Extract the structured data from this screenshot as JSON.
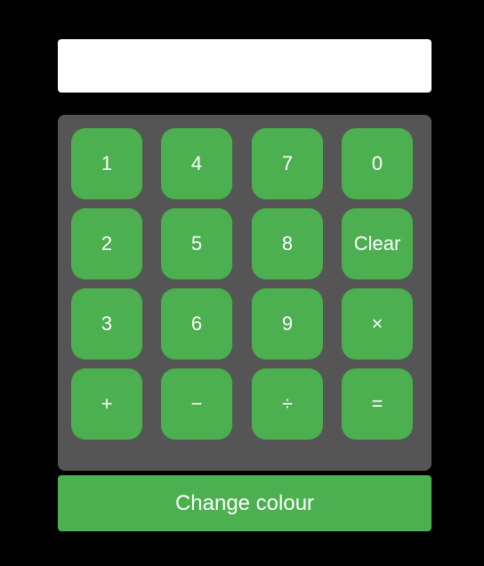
{
  "display": {
    "value": ""
  },
  "keypad": {
    "keys": [
      [
        "1",
        "4",
        "7",
        "0"
      ],
      [
        "2",
        "5",
        "8",
        "Clear"
      ],
      [
        "3",
        "6",
        "9",
        "×"
      ],
      [
        "+",
        "−",
        "÷",
        "="
      ]
    ]
  },
  "footer": {
    "change_colour_label": "Change colour"
  },
  "colors": {
    "background": "#000000",
    "display": "#ffffff",
    "keypad_panel": "#555555",
    "button": "#4caf50",
    "button_text": "#ffffff"
  }
}
